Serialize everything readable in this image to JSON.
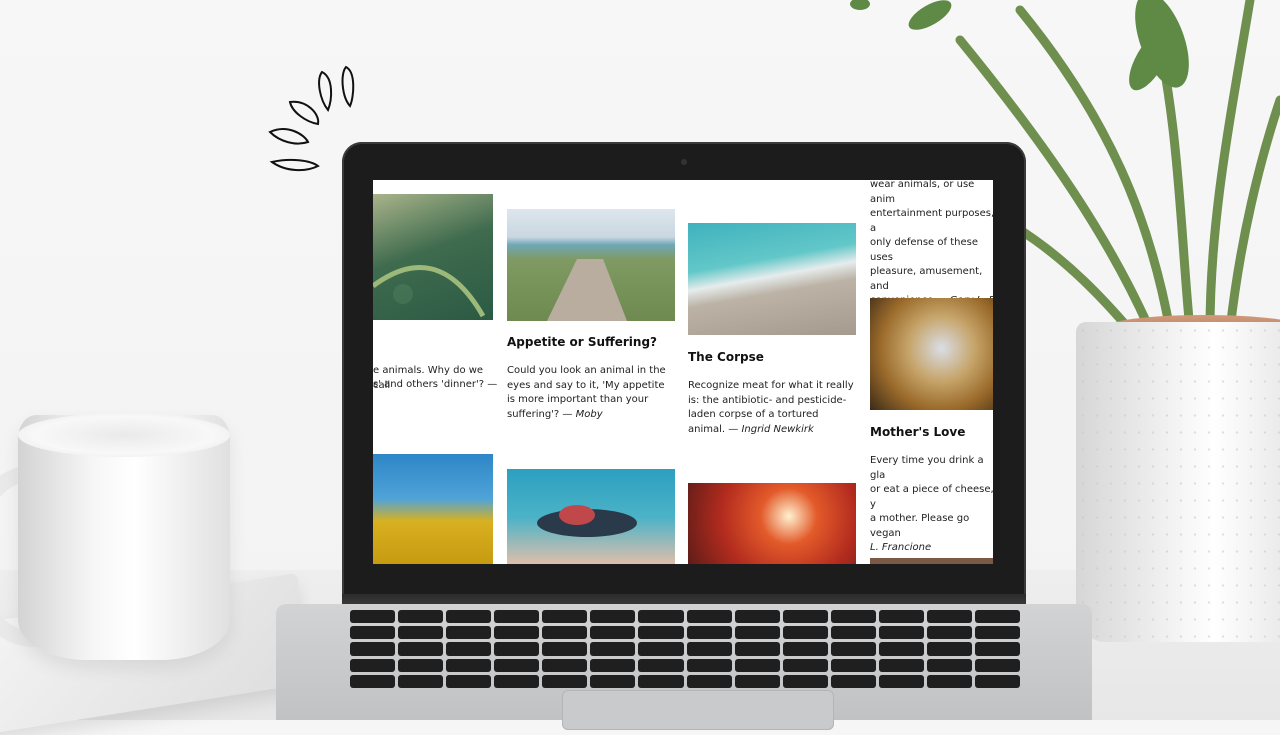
{
  "gallery": {
    "col1": {
      "partial_text": "e animals. Why do we call",
      "partial_text_2": "s' and others 'dinner'? —"
    },
    "col2": {
      "title": "Appetite or Suffering?",
      "quote": "Could you look an animal in the eyes and say to it, 'My appetite is more important than your suffering'? —",
      "author": "Moby"
    },
    "col3": {
      "title": "The Corpse",
      "quote": "Recognize meat for what it really is: the antibiotic- and pesticide-laden corpse of a tortured animal. —",
      "author": "Ingrid Newkirk"
    },
    "col4": {
      "top_lines": [
        "wear animals, or use anim",
        "entertainment purposes, a",
        "only defense of these uses",
        "pleasure, amusement, and"
      ],
      "top_last_line": "convenience.— ",
      "top_author": "Gary L. Fr",
      "title": "Mother's Love",
      "quote_lines": [
        "Every time you drink a gla",
        "or eat a piece of cheese, y",
        "a mother. Please go vegan"
      ],
      "author": "L. Francione"
    }
  },
  "icons": {
    "sparkle": "sparkle-doodle-icon"
  }
}
